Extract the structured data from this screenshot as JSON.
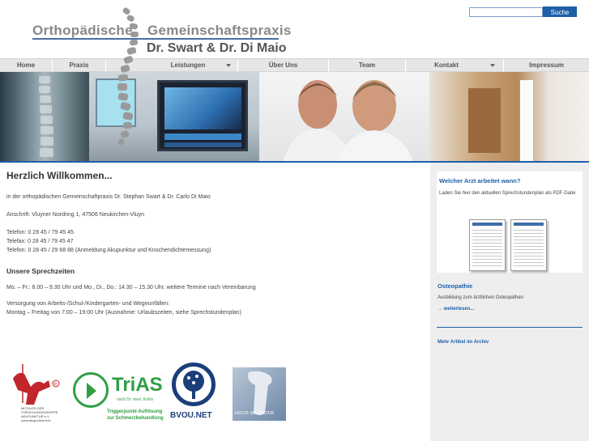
{
  "header": {
    "logo_line1_a": "Orthopädische",
    "logo_line1_b": "Gemeinschaftspraxis",
    "logo_line2": "Dr. Swart & Dr. Di Maio"
  },
  "search": {
    "placeholder": "",
    "button_label": "Suche"
  },
  "nav": {
    "items": [
      {
        "label": "Home",
        "has_dropdown": false
      },
      {
        "label": "Praxis",
        "has_dropdown": false
      },
      {
        "label": "Leistungen",
        "has_dropdown": true
      },
      {
        "label": "Über Uns",
        "has_dropdown": false
      },
      {
        "label": "Team",
        "has_dropdown": false
      },
      {
        "label": "Kontakt",
        "has_dropdown": true
      },
      {
        "label": "Impressum",
        "has_dropdown": false
      }
    ]
  },
  "main": {
    "title": "Herzlich Willkommen...",
    "intro": "in der orthopädischen Gemeinschaftpraxis Dr. Stephan Swart & Dr. Carlo Di Maio",
    "address": "Anschrift: Vluyner Nordring 1, 47506 Neukirchen-Vluyn",
    "phone": "Telefon: 0 28 45 / 79 45 45",
    "fax": "Telefax: 0 28 45 / 79 45 47",
    "phone2": "Telefon: 0 28 45 / 29 68 88 (Anmeldung Akupunktur und Knochendichtemessung)",
    "hours_title": "Unsere Sprechzeiten",
    "hours_text": "Mo. – Fr.: 8.00 – 9.30 Uhr und Mo., Di., Do.: 14.30 – 15.30 Uhr, weitere Termine nach Vereinbarung",
    "care_line1": "Versorgung von Arbeits-/Schul-/Kindergarten- und Wegeunfällen:",
    "care_line2": "Montag – Freitag von 7:00 – 19:00 Uhr (Ausnahme: Urlaubszeiten, siehe Sprechstundenplan)"
  },
  "sidebar": {
    "card_title": "Welcher Arzt arbeitet wann?",
    "card_text": "Laden Sie hier den aktuellen Sprechstundenplan als PDF-Datei",
    "osteo_title": "Osteopathie",
    "osteo_text": "Ausbildung zum ärztlichen Osteopathen",
    "osteo_link": "→ weiterlesen...",
    "archive_link": "Mehr Artikel im Archiv"
  },
  "logos": {
    "akupunktur": "MITGLIED DER FORSCHUNGSGRUPPE AKUPUNKTUR e.V. www.akupunktur.info",
    "trias_name": "TriAS",
    "trias_sub": "nach Dr. med. Kohls",
    "trias_tag1": "Triggerpunkt-Auflösung",
    "trias_tag2": "zur Schmerzbehandlung",
    "bvou_name": "BVOU.NET",
    "hock": "HOCK-METHODE"
  },
  "colors": {
    "brand_blue": "#1e5fa8",
    "nav_bg": "#e6e6e6",
    "sidebar_bg": "#eeeeee"
  }
}
